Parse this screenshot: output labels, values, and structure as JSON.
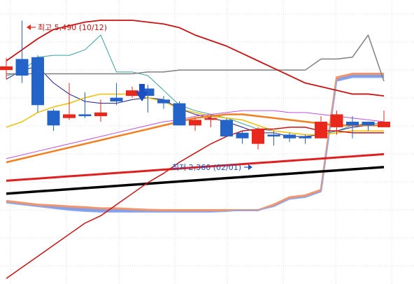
{
  "chart_data": {
    "type": "candlestick",
    "grid": true,
    "annotations": {
      "high_label": "최고 5,490 (10/12)",
      "low_label": "최저 2,360 (02/01)"
    },
    "colors": {
      "up": "#e8281c",
      "down": "#2463c8",
      "grid": "#dcdcdc",
      "ma_short": "#1c1c8c",
      "ma_teal": "#3aa0a0",
      "ma_yellow": "#f0c000",
      "ma_orange": "#f08020",
      "ma_violet": "#c050e0",
      "ma_red": "#e02020",
      "ma_black": "#000000",
      "gray_line": "#808080",
      "envelope_red": "#cc1111",
      "cloud_blue": "#6a8fe8",
      "cloud_orange": "#f2956a",
      "arrow_blue": "#1d4fc4"
    },
    "candles": [
      {
        "open": 4150,
        "close": 4250,
        "high": 4480,
        "low": 3900
      },
      {
        "open": 4450,
        "close": 4000,
        "high": 5490,
        "low": 3800
      },
      {
        "open": 4500,
        "close": 3200,
        "high": 4550,
        "low": 3000
      },
      {
        "open": 3050,
        "close": 2650,
        "high": 3100,
        "low": 2500
      },
      {
        "open": 2850,
        "close": 2950,
        "high": 3800,
        "low": 2800
      },
      {
        "open": 2950,
        "close": 2900,
        "high": 3550,
        "low": 2850
      },
      {
        "open": 2900,
        "close": 3000,
        "high": 3350,
        "low": 2750
      },
      {
        "open": 3400,
        "close": 3300,
        "high": 3800,
        "low": 3200
      },
      {
        "open": 3450,
        "close": 3600,
        "high": 3700,
        "low": 3400
      },
      {
        "open": 3650,
        "close": 3450,
        "high": 3750,
        "low": 3000
      },
      {
        "open": 3350,
        "close": 3250,
        "high": 3450,
        "low": 3100
      },
      {
        "open": 3250,
        "close": 2650,
        "high": 3300,
        "low": 2650
      },
      {
        "open": 2650,
        "close": 2800,
        "high": 2850,
        "low": 2500
      },
      {
        "open": 2800,
        "close": 2850,
        "high": 2950,
        "low": 2600
      },
      {
        "open": 2800,
        "close": 2350,
        "high": 2850,
        "low": 2350
      },
      {
        "open": 2450,
        "close": 2300,
        "high": 2500,
        "low": 2150
      },
      {
        "open": 2150,
        "close": 2550,
        "high": 2600,
        "low": 2000
      },
      {
        "open": 2400,
        "close": 2350,
        "high": 2500,
        "low": 2100
      },
      {
        "open": 2400,
        "close": 2300,
        "high": 2450,
        "low": 2200
      },
      {
        "open": 2350,
        "close": 2300,
        "high": 2400,
        "low": 2150
      },
      {
        "open": 2300,
        "close": 2750,
        "high": 2900,
        "low": 2300
      },
      {
        "open": 2600,
        "close": 2950,
        "high": 3050,
        "low": 2400
      },
      {
        "open": 2750,
        "close": 2650,
        "high": 2900,
        "low": 2300
      },
      {
        "open": 2750,
        "close": 2650,
        "high": 2750,
        "low": 2500
      },
      {
        "open": 2600,
        "close": 2750,
        "high": 3050,
        "low": 2600
      }
    ],
    "overlays": [
      {
        "key": "ma_short",
        "values": [
          3900,
          4150,
          4250,
          3800,
          3500,
          3300,
          3250,
          3250,
          3350,
          3400,
          3350,
          3100,
          2950,
          2850,
          2750,
          2600,
          2450,
          2450,
          2350,
          2350,
          2400,
          2500,
          2600,
          2650,
          2650
        ]
      },
      {
        "key": "ma_teal",
        "values": [
          4000,
          4100,
          4500,
          4550,
          4550,
          4700,
          5100,
          4100,
          4100,
          4000,
          3600,
          3200,
          3050,
          2950,
          2850,
          2700,
          2550,
          2500,
          2450,
          2400,
          2400,
          2500,
          2650,
          2700,
          2700
        ]
      },
      {
        "key": "ma_yellow",
        "values": [
          2600,
          2750,
          3000,
          3150,
          3250,
          3400,
          3500,
          3500,
          3500,
          3400,
          3300,
          3100,
          3000,
          2900,
          2850,
          2800,
          2650,
          2500,
          2450,
          2400,
          2400,
          2450,
          2500,
          2500,
          2500
        ]
      },
      {
        "key": "ma_violet",
        "values": [
          1750,
          1850,
          1950,
          2050,
          2150,
          2250,
          2350,
          2450,
          2550,
          2650,
          2750,
          2800,
          2900,
          2950,
          3000,
          3050,
          3050,
          3050,
          3000,
          3000,
          2950,
          2900,
          2850,
          2800,
          2750
        ]
      },
      {
        "key": "ma_orange",
        "values": [
          1650,
          1750,
          1850,
          1950,
          2050,
          2150,
          2250,
          2350,
          2450,
          2550,
          2650,
          2750,
          2850,
          2900,
          2950,
          2950,
          2900,
          2850,
          2800,
          2750,
          2700,
          2650,
          2650,
          2650,
          2650
        ]
      },
      {
        "key": "ma_red",
        "values": [
          1150,
          1180,
          1210,
          1240,
          1270,
          1300,
          1330,
          1360,
          1390,
          1420,
          1450,
          1480,
          1510,
          1540,
          1570,
          1600,
          1630,
          1660,
          1690,
          1720,
          1750,
          1780,
          1810,
          1840,
          1870
        ]
      },
      {
        "key": "ma_black",
        "values": [
          800,
          830,
          860,
          890,
          920,
          950,
          980,
          1010,
          1040,
          1070,
          1100,
          1130,
          1160,
          1190,
          1220,
          1250,
          1280,
          1310,
          1340,
          1370,
          1400,
          1430,
          1460,
          1490,
          1520
        ]
      },
      {
        "key": "gray_line",
        "values": [
          4050,
          4050,
          4050,
          4050,
          4050,
          4050,
          4050,
          4050,
          4050,
          4100,
          4100,
          4150,
          4150,
          4150,
          4150,
          4150,
          4150,
          4150,
          4150,
          4150,
          4450,
          4450,
          4500,
          5100,
          3850
        ]
      },
      {
        "key": "envelope_upper",
        "values": [
          4400,
          4700,
          5000,
          5250,
          5350,
          5450,
          5500,
          5500,
          5500,
          5450,
          5400,
          5300,
          5100,
          4950,
          4800,
          4600,
          4400,
          4200,
          4000,
          3800,
          3700,
          3600,
          3500,
          3500,
          3450
        ]
      },
      {
        "key": "envelope_lower",
        "values": [
          -1500,
          -1200,
          -900,
          -600,
          -300,
          0,
          200,
          500,
          800,
          1100,
          1350,
          1650,
          1900,
          2150,
          2350,
          2500,
          2550,
          2550,
          2600,
          2600,
          2500,
          2500,
          2450,
          2450,
          2450
        ]
      }
    ],
    "cloud": {
      "upper": [
        600,
        550,
        500,
        480,
        450,
        430,
        400,
        400,
        380,
        360,
        350,
        350,
        350,
        350,
        350,
        350,
        350,
        500,
        700,
        750,
        900,
        3950,
        4050,
        4050,
        4050
      ],
      "lower": [
        550,
        500,
        450,
        400,
        350,
        320,
        300,
        300,
        300,
        300,
        300,
        300,
        300,
        300,
        320,
        350,
        350,
        450,
        650,
        700,
        850,
        3850,
        3950,
        3950,
        3950
      ]
    },
    "ylim": [
      -1650,
      6050
    ]
  }
}
